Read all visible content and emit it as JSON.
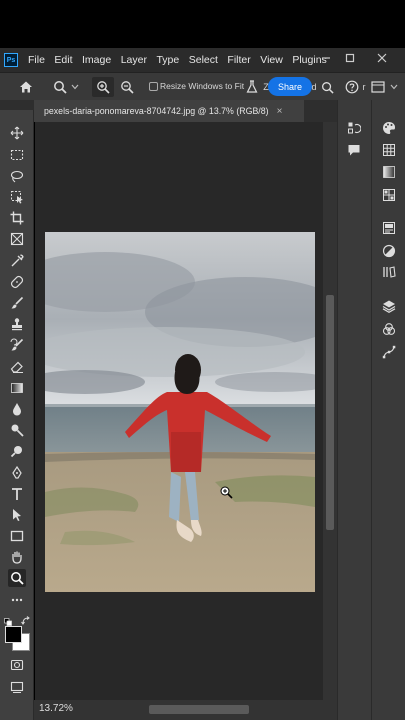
{
  "menubar": {
    "logo": "Ps",
    "items": [
      "File",
      "Edit",
      "Image",
      "Layer",
      "Type",
      "Select",
      "Filter",
      "View",
      "Plugins"
    ]
  },
  "options": {
    "resize_label": "Resize Windows to Fit",
    "zoom_partial": "Z",
    "share_label": "Share",
    "partial_d": "d",
    "partial_r": "r"
  },
  "document": {
    "tab_title": "pexels-daria-ponomareva-8704742.jpg @ 13.7% (RGB/8)",
    "close": "×"
  },
  "status": {
    "zoom": "13.72%"
  },
  "icons": {
    "home": "home-icon",
    "zoom": "zoom-icon",
    "zoom_in": "zoom-in-icon",
    "zoom_out": "zoom-out-icon",
    "flask": "flask-icon",
    "search": "search-icon",
    "help": "help-icon",
    "workspace": "workspace-icon"
  },
  "colors": {
    "share": "#1473e6",
    "ps_blue": "#31a8ff"
  }
}
